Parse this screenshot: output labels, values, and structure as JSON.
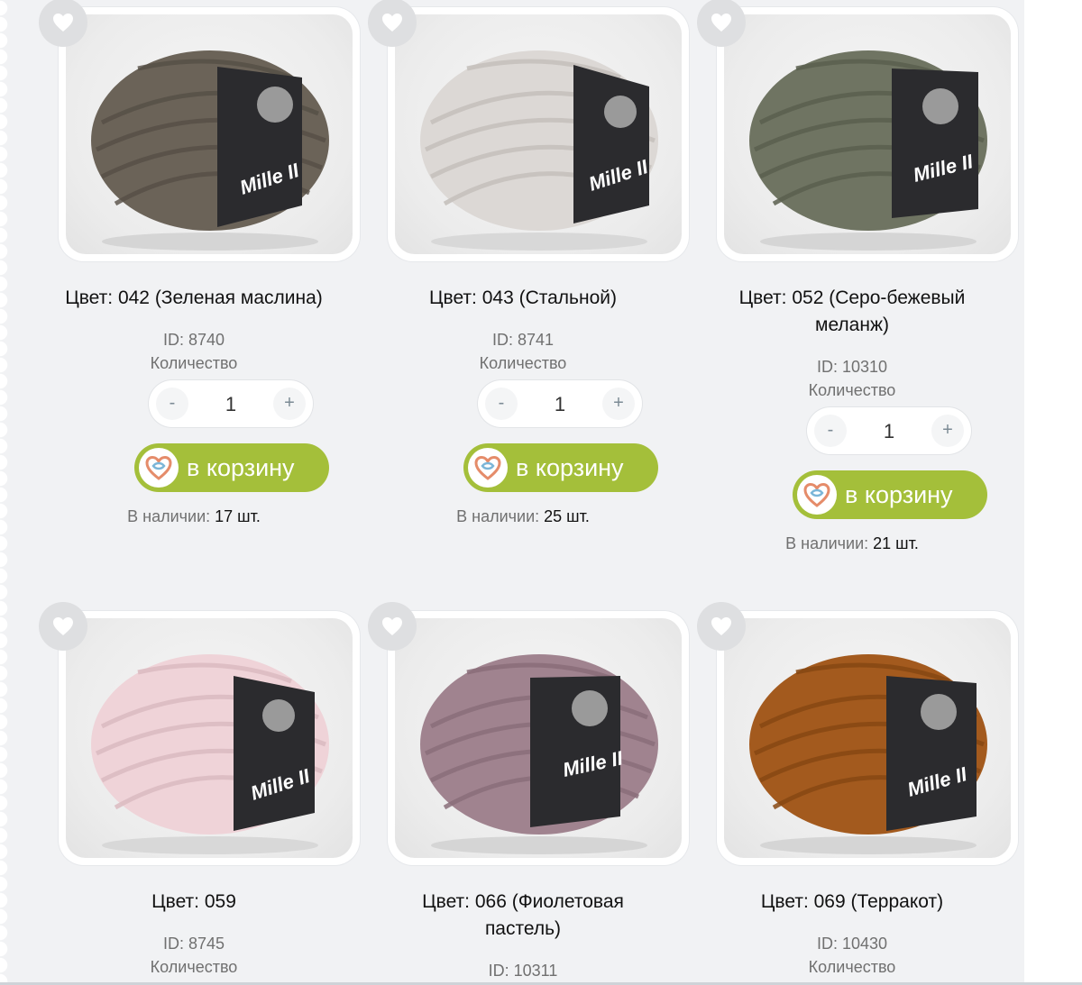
{
  "favorite_icon": "heart-icon",
  "cart_logo_icon": "heart-yarn-logo-icon",
  "accent_color": "#a4bf3a",
  "products": [
    {
      "title": "Цвет: 042 (Зеленая маслина)",
      "id_text": "ID: 8740",
      "qty_label": "Количество",
      "qty_value": "1",
      "minus_label": "-",
      "plus_label": "+",
      "cart_label": "в корзину",
      "stock_prefix": "В наличии:",
      "stock_value": "17 шт.",
      "yarn_color": "#6b6358",
      "band_label": "Mille II"
    },
    {
      "title": "Цвет: 043 (Стальной)",
      "id_text": "ID: 8741",
      "qty_label": "Количество",
      "qty_value": "1",
      "minus_label": "-",
      "plus_label": "+",
      "cart_label": "в корзину",
      "stock_prefix": "В наличии:",
      "stock_value": "25 шт.",
      "yarn_color": "#dcd8d5",
      "band_label": "Mille II"
    },
    {
      "title_line1": "Цвет: 052 (Серо-бежевый",
      "title_line2": "меланж)",
      "id_text": "ID: 10310",
      "qty_label": "Количество",
      "qty_value": "1",
      "minus_label": "-",
      "plus_label": "+",
      "cart_label": "в корзину",
      "stock_prefix": "В наличии:",
      "stock_value": "21 шт.",
      "yarn_color": "#6f7462",
      "band_label": "Mille II"
    },
    {
      "title": "Цвет: 059",
      "id_text": "ID: 8745",
      "qty_label": "Количество",
      "yarn_color": "#efd3d8",
      "band_label": "Mille II"
    },
    {
      "title_line1": "Цвет: 066 (Фиолетовая",
      "title_line2": "пастель)",
      "id_text": "ID: 10311",
      "yarn_color": "#a0838f",
      "band_label": "Mille II"
    },
    {
      "title": "Цвет: 069 (Терракот)",
      "id_text": "ID: 10430",
      "qty_label": "Количество",
      "yarn_color": "#a35a1e",
      "band_label": "Mille II"
    }
  ]
}
